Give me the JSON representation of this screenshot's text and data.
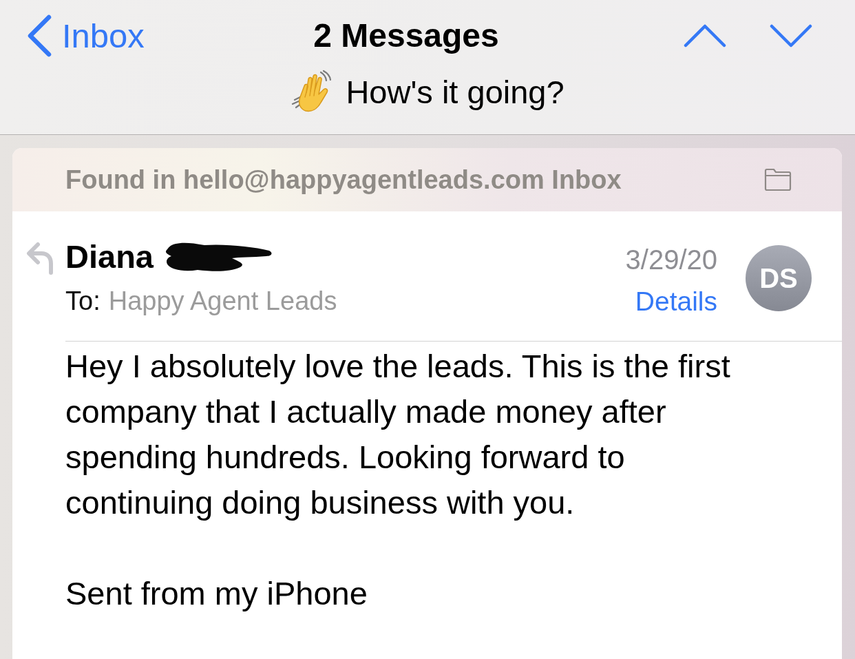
{
  "nav": {
    "back_label": "Inbox",
    "title": "2 Messages",
    "subject": "How's it going?"
  },
  "mailbox_banner": {
    "text": "Found in hello@happyagentleads.com Inbox"
  },
  "message": {
    "replied": true,
    "sender": "Diana",
    "surname_redacted": true,
    "date": "3/29/20",
    "to_label": "To:",
    "recipient": "Happy Agent Leads",
    "details_link": "Details",
    "avatar_initials": "DS",
    "body": [
      "Hey I absolutely love the leads. This is the first company that I actually made money after spending hundreds. Looking forward to continuing doing business with you.",
      "Sent from my iPhone"
    ]
  }
}
